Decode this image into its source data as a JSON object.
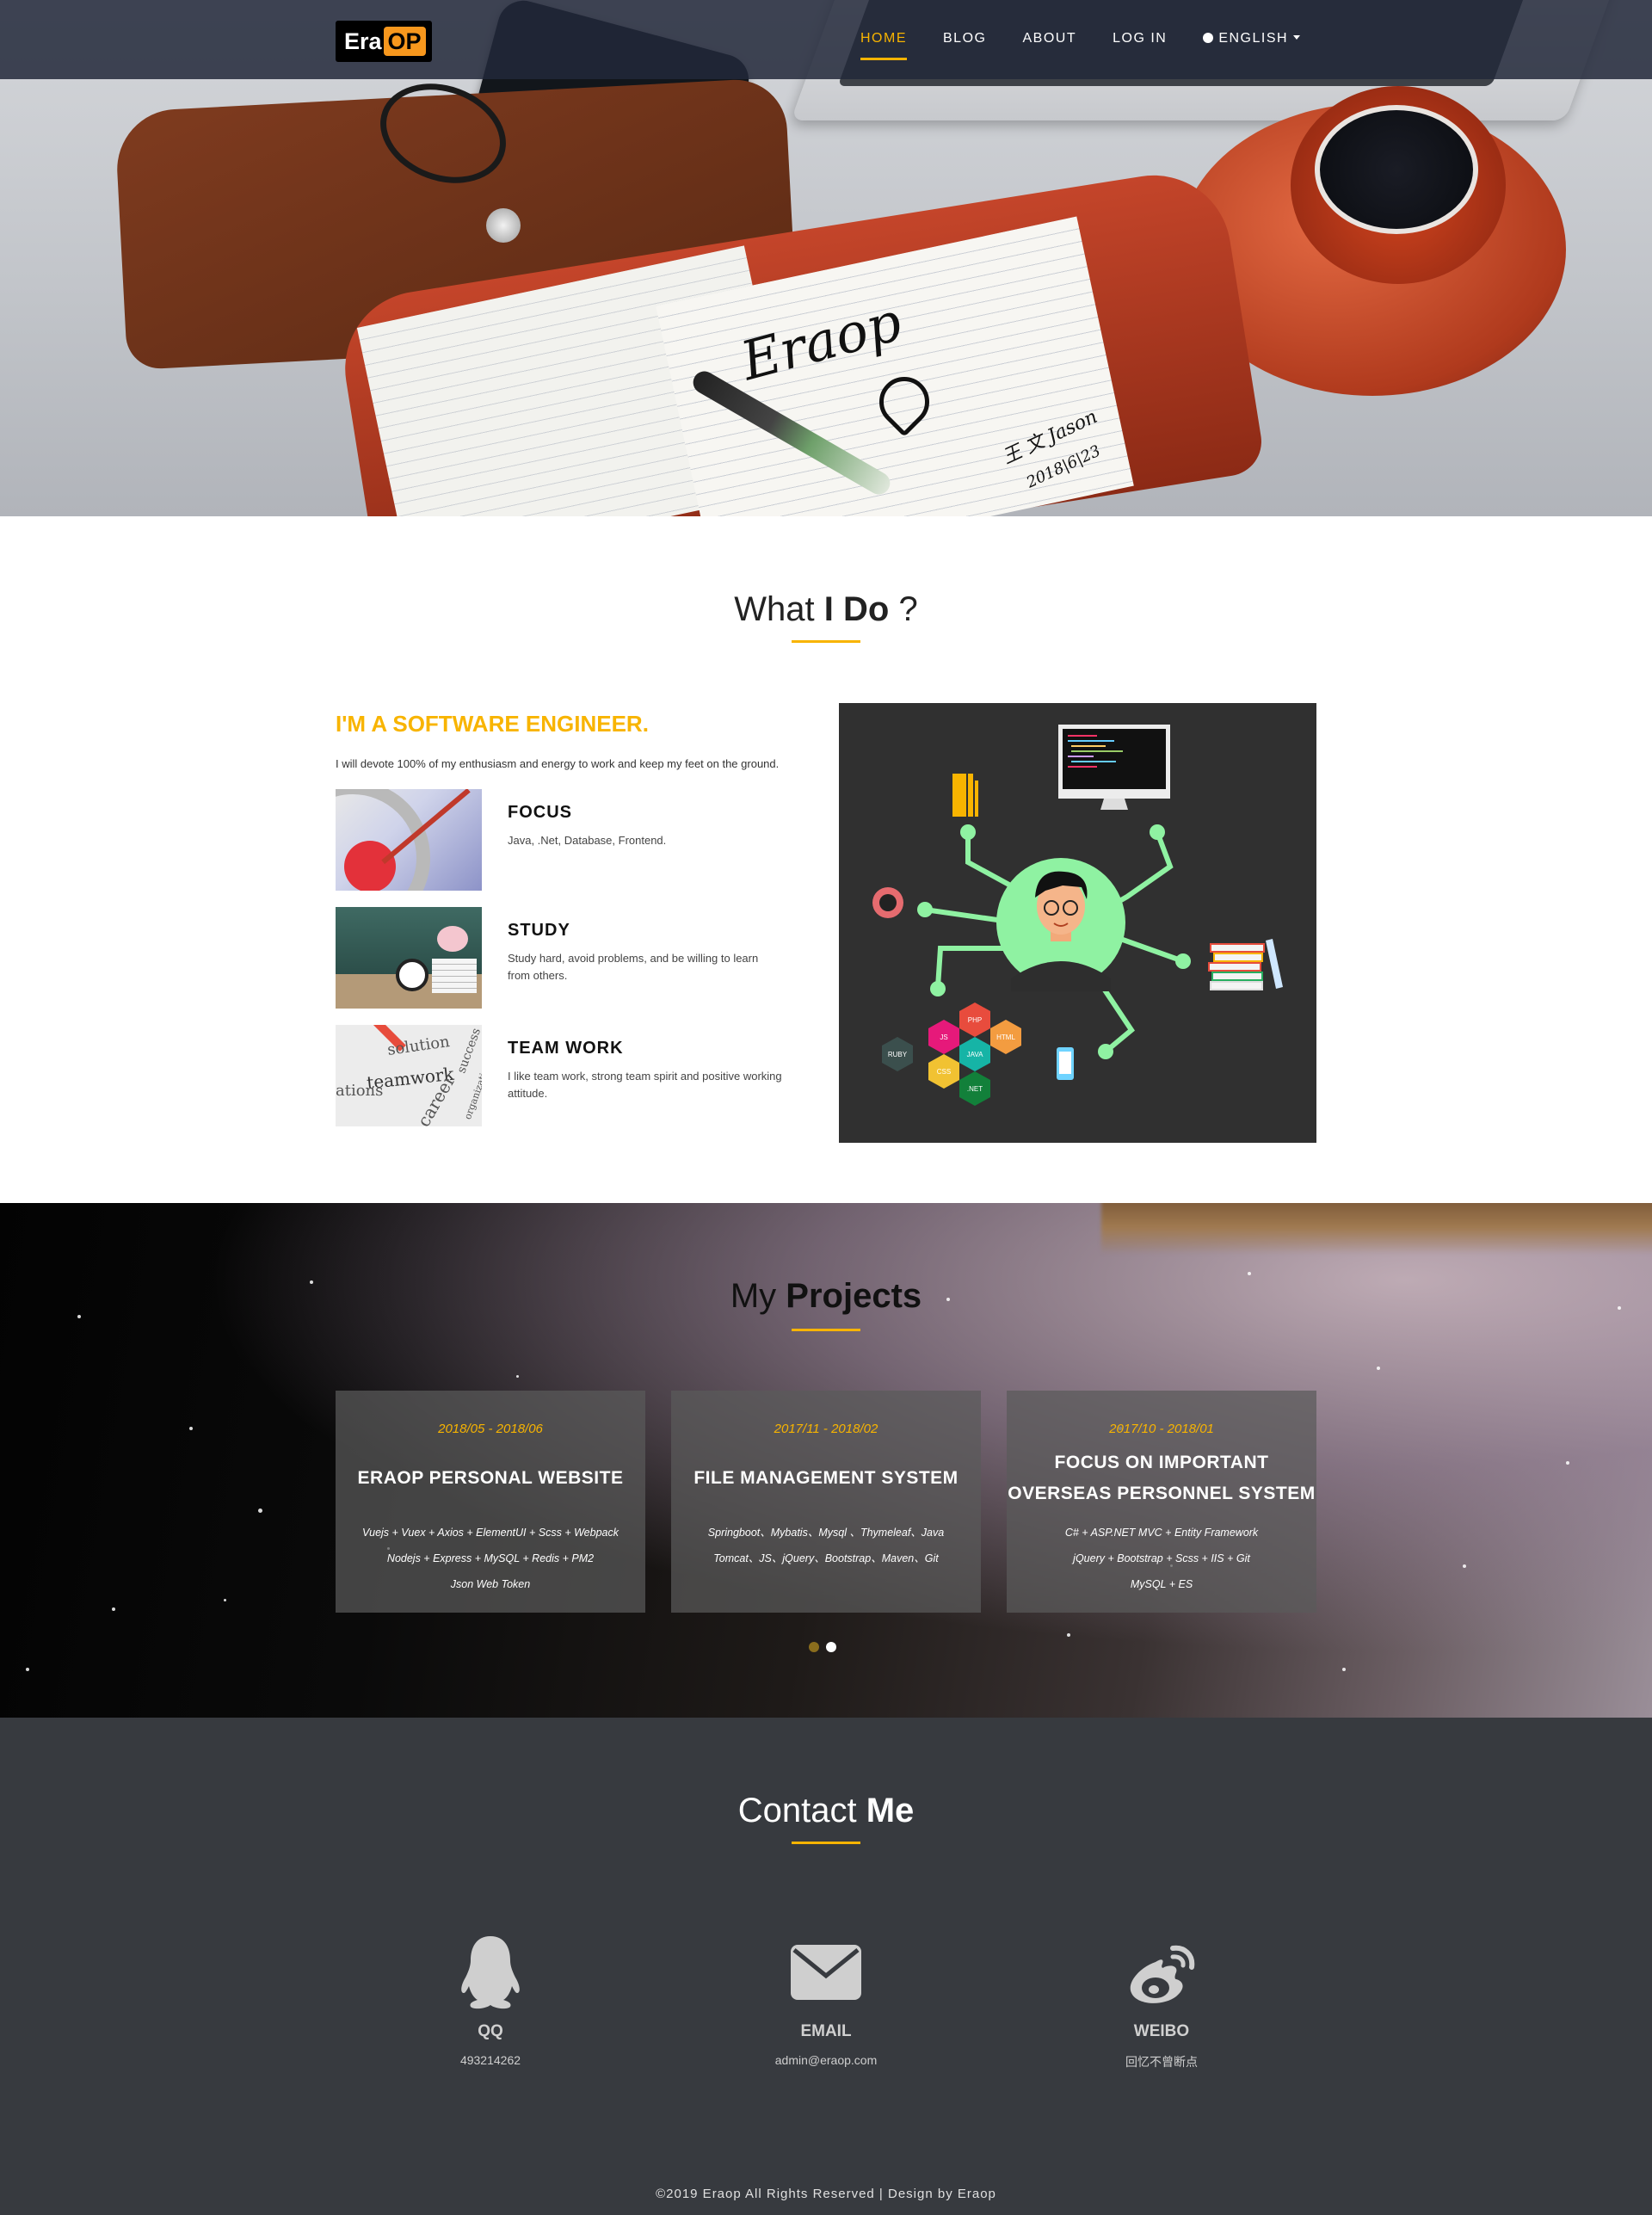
{
  "nav": {
    "logo_left": "Era",
    "logo_right": "OP",
    "items": [
      {
        "label": "HOME",
        "active": true
      },
      {
        "label": "BLOG",
        "active": false
      },
      {
        "label": "ABOUT",
        "active": false
      },
      {
        "label": "LOG IN",
        "active": false
      }
    ],
    "language": "ENGLISH",
    "language_icon": "globe-icon"
  },
  "hero": {
    "signature": "Eraop",
    "signature_small": "王 文   Jason",
    "date": "2018|6|23"
  },
  "what": {
    "title_pre": "What ",
    "title_bold": "I Do",
    "title_post": " ?",
    "tagline": "I'M A SOFTWARE ENGINEER.",
    "intro": "I will devote 100% of my enthusiasm and energy to work and keep my feet on the ground.",
    "features": [
      {
        "title": "FOCUS",
        "text": "Java, .Net, Database, Frontend."
      },
      {
        "title": "STUDY",
        "text": "Study hard, avoid problems, and be willing to learn from others."
      },
      {
        "title": "TEAM WORK",
        "text": "I like team work, strong team spirit and positive working attitude."
      }
    ],
    "team_words": [
      "solution",
      "success",
      "teamwork",
      "ations",
      "career",
      "organization"
    ],
    "hex_labels": [
      "PHP",
      "JS",
      "HTML",
      "RUBY",
      "JAVA",
      "CSS",
      ".NET"
    ]
  },
  "projects": {
    "title_pre": "My ",
    "title_bold": "Projects",
    "cards": [
      {
        "dates": "2018/05 - 2018/06",
        "name_lines": [
          "ERAOP PERSONAL WEBSITE"
        ],
        "tech_lines": [
          "Vuejs + Vuex + Axios + ElementUI + Scss + Webpack",
          "Nodejs + Express + MySQL + Redis + PM2",
          "Json Web Token"
        ]
      },
      {
        "dates": "2017/11 - 2018/02",
        "name_lines": [
          "FILE MANAGEMENT SYSTEM"
        ],
        "tech_lines": [
          "Springboot、Mybatis、Mysql 、Thymeleaf、Java",
          "Tomcat、JS、jQuery、Bootstrap、Maven、Git"
        ]
      },
      {
        "dates": "2017/10 - 2018/01",
        "name_lines": [
          "FOCUS ON IMPORTANT",
          "OVERSEAS PERSONNEL SYSTEM"
        ],
        "tech_lines": [
          "C# + ASP.NET MVC + Entity Framework",
          "jQuery + Bootstrap + Scss + IIS + Git",
          "MySQL + ES"
        ]
      }
    ],
    "carousel_dots": [
      {
        "active": false,
        "color": "#8a6d1d"
      },
      {
        "active": true,
        "color": "#ffffff"
      }
    ]
  },
  "contact": {
    "title_pre": "Contact ",
    "title_bold": "Me",
    "items": [
      {
        "icon": "qq-penguin-icon",
        "label": "QQ",
        "value": "493214262"
      },
      {
        "icon": "envelope-icon",
        "label": "EMAIL",
        "value": "admin@eraop.com"
      },
      {
        "icon": "weibo-icon",
        "label": "WEIBO",
        "value": "回忆不曾断点"
      }
    ],
    "footer": "©2019 Eraop All Rights Reserved | Design by Eraop"
  },
  "colors": {
    "accent": "#f8b400",
    "nav_bg": "#22283a",
    "contact_bg": "#373a3f",
    "illus_bg": "#303030"
  }
}
